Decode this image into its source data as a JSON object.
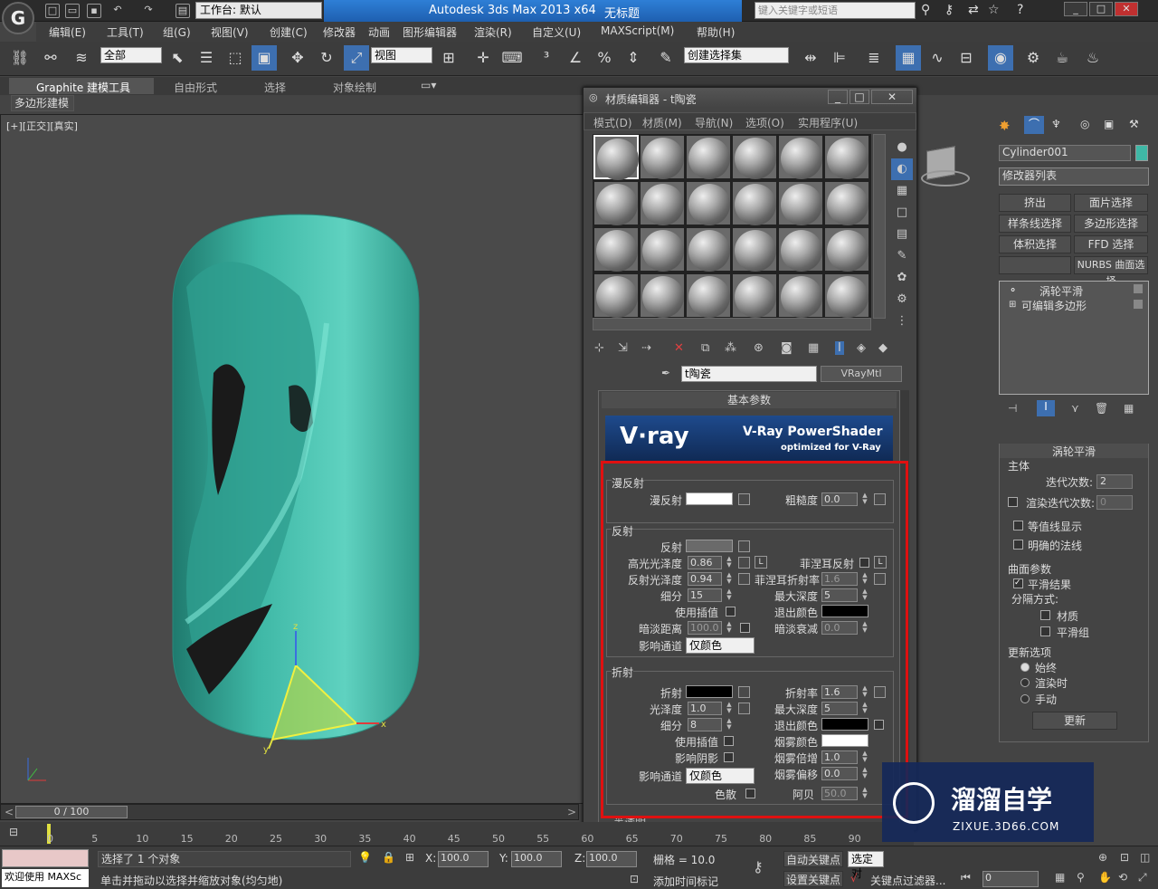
{
  "app": {
    "title": "Autodesk 3ds Max  2013 x64",
    "doc_title": "无标题",
    "workspace": "工作台: 默认",
    "search_placeholder": "键入关键字或短语"
  },
  "menu": [
    "编辑(E)",
    "工具(T)",
    "组(G)",
    "视图(V)",
    "创建(C)",
    "修改器",
    "动画",
    "图形编辑器",
    "渲染(R)",
    "自定义(U)",
    "MAXScript(M)",
    "帮助(H)"
  ],
  "toolbar": {
    "select_filter": "全部",
    "ref_coord": "视图",
    "named_sel": "创建选择集"
  },
  "ribbon": {
    "tabs": [
      "Graphite 建模工具",
      "自由形式",
      "选择",
      "对象绘制"
    ],
    "sub": "多边形建模"
  },
  "viewport": {
    "label": "[+][正交][真实]"
  },
  "material_editor": {
    "title": "材质编辑器 - t陶瓷",
    "menu": [
      "模式(D)",
      "材质(M)",
      "导航(N)",
      "选项(O)",
      "实用程序(U)"
    ],
    "mat_name": "t陶瓷",
    "mat_type": "VRayMtl",
    "rollout": "基本参数",
    "vray_banner": "V-Ray PowerShader",
    "vray_sub": "optimized for V-Ray",
    "vray_logo": "V·ray",
    "diffuse": {
      "group": "漫反射",
      "label": "漫反射",
      "rough_label": "粗糙度",
      "rough": "0.0"
    },
    "reflection": {
      "group": "反射",
      "reflect": "反射",
      "hilight_label": "高光光泽度",
      "hilight": "0.86",
      "refl_gloss_label": "反射光泽度",
      "refl_gloss": "0.94",
      "subdiv_label": "细分",
      "subdiv": "15",
      "interp": "使用插值",
      "dim_dist_label": "暗淡距离",
      "dim_dist": "100.0",
      "channel_label": "影响通道",
      "channel": "仅颜色",
      "fresnel": "菲涅耳反射",
      "fresnel_ior_label": "菲涅耳折射率",
      "fresnel_ior": "1.6",
      "max_depth_label": "最大深度",
      "max_depth": "5",
      "exit_color": "退出颜色",
      "dim_falloff_label": "暗淡衰减",
      "dim_falloff": "0.0",
      "L": "L"
    },
    "refraction": {
      "group": "折射",
      "refract": "折射",
      "ior_label": "折射率",
      "ior": "1.6",
      "gloss_label": "光泽度",
      "gloss": "1.0",
      "max_depth_label": "最大深度",
      "max_depth": "5",
      "subdiv_label": "细分",
      "subdiv": "8",
      "exit_color": "退出颜色",
      "interp": "使用插值",
      "fog_color": "烟雾颜色",
      "shadows": "影响阴影",
      "fog_mult_label": "烟雾倍增",
      "fog_mult": "1.0",
      "channel_label": "影响通道",
      "channel": "仅颜色",
      "fog_bias_label": "烟雾偏移",
      "fog_bias": "0.0",
      "dispersion": "色散",
      "abbe_label": "阿贝",
      "abbe": "50.0"
    },
    "translucency": "半透明"
  },
  "command_panel": {
    "object_name": "Cylinder001",
    "modifier_list": "修改器列表",
    "buttons": [
      "挤出",
      "面片选择",
      "样条线选择",
      "多边形选择",
      "体积选择",
      "FFD 选择",
      "",
      "NURBS 曲面选择"
    ],
    "stack": [
      "涡轮平滑",
      "可编辑多边形"
    ],
    "turbosmooth": {
      "title": "涡轮平滑",
      "main": "主体",
      "iterations_label": "迭代次数:",
      "iterations": "2",
      "render_iters_label": "渲染迭代次数:",
      "render_iters": "0",
      "isoline": "等值线显示",
      "explicit": "明确的法线",
      "surface": "曲面参数",
      "smooth_result": "平滑结果",
      "separate": "分隔方式:",
      "materials": "材质",
      "smoothing": "平滑组",
      "update": "更新选项",
      "always": "始终",
      "render_time": "渲染时",
      "manual": "手动",
      "update_btn": "更新"
    }
  },
  "timeline": {
    "frame": "0 / 100",
    "ticks": [
      "0",
      "5",
      "10",
      "15",
      "20",
      "25",
      "30",
      "35",
      "40",
      "45",
      "50",
      "55",
      "60",
      "65",
      "70",
      "75",
      "80",
      "85",
      "90"
    ]
  },
  "status": {
    "selected": "选择了 1 个对象",
    "hint": "单击并拖动以选择并缩放对象(均匀地)",
    "welcome": "欢迎使用 MAXSc",
    "x_label": "X:",
    "x": "100.0",
    "y_label": "Y:",
    "y": "100.0",
    "z_label": "Z:",
    "z": "100.0",
    "grid": "栅格 = 10.0",
    "auto_key": "自动关键点",
    "set_key": "设置关键点",
    "selected_obj": "选定对",
    "key_filter": "关键点过滤器...",
    "add_time_tag": "添加时间标记",
    "frame": "0"
  },
  "watermark": {
    "title": "溜溜自学",
    "url": "ZIXUE.3D66.COM"
  },
  "colors": {
    "object": "#3fb8a6",
    "accent_red": "#e01010"
  }
}
